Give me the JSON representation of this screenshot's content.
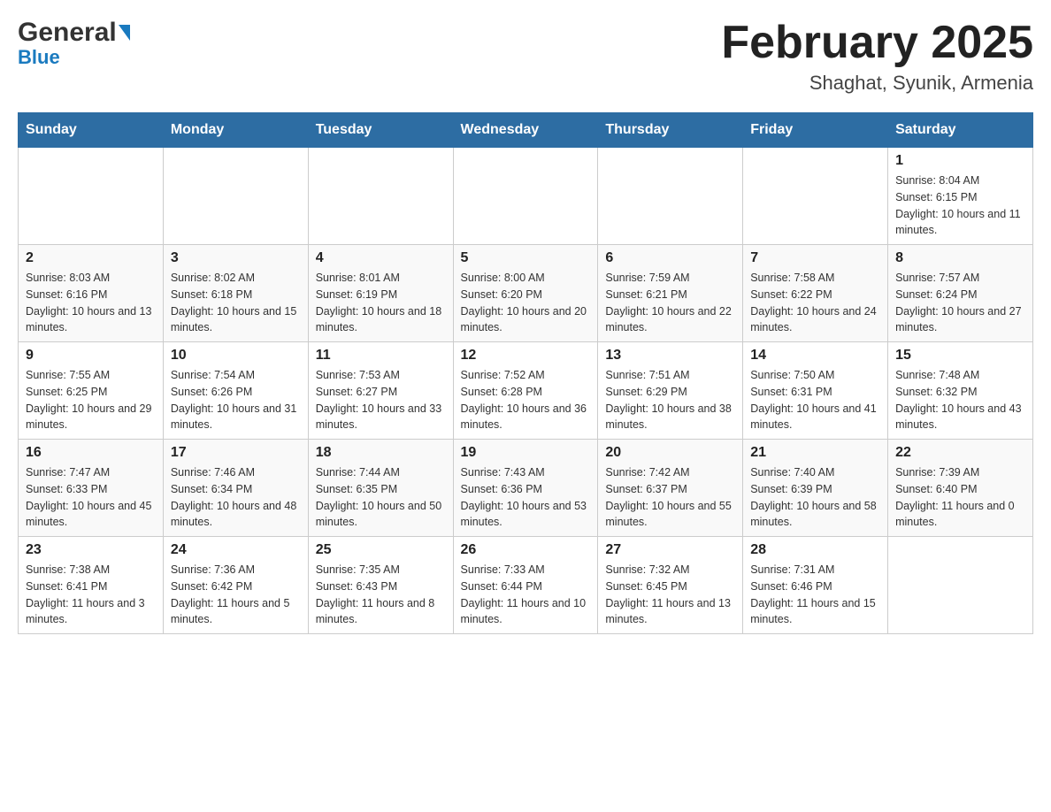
{
  "header": {
    "logo_general": "General",
    "logo_blue": "Blue",
    "month_year": "February 2025",
    "location": "Shaghat, Syunik, Armenia"
  },
  "weekdays": [
    "Sunday",
    "Monday",
    "Tuesday",
    "Wednesday",
    "Thursday",
    "Friday",
    "Saturday"
  ],
  "weeks": [
    [
      {
        "day": "",
        "info": ""
      },
      {
        "day": "",
        "info": ""
      },
      {
        "day": "",
        "info": ""
      },
      {
        "day": "",
        "info": ""
      },
      {
        "day": "",
        "info": ""
      },
      {
        "day": "",
        "info": ""
      },
      {
        "day": "1",
        "info": "Sunrise: 8:04 AM\nSunset: 6:15 PM\nDaylight: 10 hours and 11 minutes."
      }
    ],
    [
      {
        "day": "2",
        "info": "Sunrise: 8:03 AM\nSunset: 6:16 PM\nDaylight: 10 hours and 13 minutes."
      },
      {
        "day": "3",
        "info": "Sunrise: 8:02 AM\nSunset: 6:18 PM\nDaylight: 10 hours and 15 minutes."
      },
      {
        "day": "4",
        "info": "Sunrise: 8:01 AM\nSunset: 6:19 PM\nDaylight: 10 hours and 18 minutes."
      },
      {
        "day": "5",
        "info": "Sunrise: 8:00 AM\nSunset: 6:20 PM\nDaylight: 10 hours and 20 minutes."
      },
      {
        "day": "6",
        "info": "Sunrise: 7:59 AM\nSunset: 6:21 PM\nDaylight: 10 hours and 22 minutes."
      },
      {
        "day": "7",
        "info": "Sunrise: 7:58 AM\nSunset: 6:22 PM\nDaylight: 10 hours and 24 minutes."
      },
      {
        "day": "8",
        "info": "Sunrise: 7:57 AM\nSunset: 6:24 PM\nDaylight: 10 hours and 27 minutes."
      }
    ],
    [
      {
        "day": "9",
        "info": "Sunrise: 7:55 AM\nSunset: 6:25 PM\nDaylight: 10 hours and 29 minutes."
      },
      {
        "day": "10",
        "info": "Sunrise: 7:54 AM\nSunset: 6:26 PM\nDaylight: 10 hours and 31 minutes."
      },
      {
        "day": "11",
        "info": "Sunrise: 7:53 AM\nSunset: 6:27 PM\nDaylight: 10 hours and 33 minutes."
      },
      {
        "day": "12",
        "info": "Sunrise: 7:52 AM\nSunset: 6:28 PM\nDaylight: 10 hours and 36 minutes."
      },
      {
        "day": "13",
        "info": "Sunrise: 7:51 AM\nSunset: 6:29 PM\nDaylight: 10 hours and 38 minutes."
      },
      {
        "day": "14",
        "info": "Sunrise: 7:50 AM\nSunset: 6:31 PM\nDaylight: 10 hours and 41 minutes."
      },
      {
        "day": "15",
        "info": "Sunrise: 7:48 AM\nSunset: 6:32 PM\nDaylight: 10 hours and 43 minutes."
      }
    ],
    [
      {
        "day": "16",
        "info": "Sunrise: 7:47 AM\nSunset: 6:33 PM\nDaylight: 10 hours and 45 minutes."
      },
      {
        "day": "17",
        "info": "Sunrise: 7:46 AM\nSunset: 6:34 PM\nDaylight: 10 hours and 48 minutes."
      },
      {
        "day": "18",
        "info": "Sunrise: 7:44 AM\nSunset: 6:35 PM\nDaylight: 10 hours and 50 minutes."
      },
      {
        "day": "19",
        "info": "Sunrise: 7:43 AM\nSunset: 6:36 PM\nDaylight: 10 hours and 53 minutes."
      },
      {
        "day": "20",
        "info": "Sunrise: 7:42 AM\nSunset: 6:37 PM\nDaylight: 10 hours and 55 minutes."
      },
      {
        "day": "21",
        "info": "Sunrise: 7:40 AM\nSunset: 6:39 PM\nDaylight: 10 hours and 58 minutes."
      },
      {
        "day": "22",
        "info": "Sunrise: 7:39 AM\nSunset: 6:40 PM\nDaylight: 11 hours and 0 minutes."
      }
    ],
    [
      {
        "day": "23",
        "info": "Sunrise: 7:38 AM\nSunset: 6:41 PM\nDaylight: 11 hours and 3 minutes."
      },
      {
        "day": "24",
        "info": "Sunrise: 7:36 AM\nSunset: 6:42 PM\nDaylight: 11 hours and 5 minutes."
      },
      {
        "day": "25",
        "info": "Sunrise: 7:35 AM\nSunset: 6:43 PM\nDaylight: 11 hours and 8 minutes."
      },
      {
        "day": "26",
        "info": "Sunrise: 7:33 AM\nSunset: 6:44 PM\nDaylight: 11 hours and 10 minutes."
      },
      {
        "day": "27",
        "info": "Sunrise: 7:32 AM\nSunset: 6:45 PM\nDaylight: 11 hours and 13 minutes."
      },
      {
        "day": "28",
        "info": "Sunrise: 7:31 AM\nSunset: 6:46 PM\nDaylight: 11 hours and 15 minutes."
      },
      {
        "day": "",
        "info": ""
      }
    ]
  ]
}
